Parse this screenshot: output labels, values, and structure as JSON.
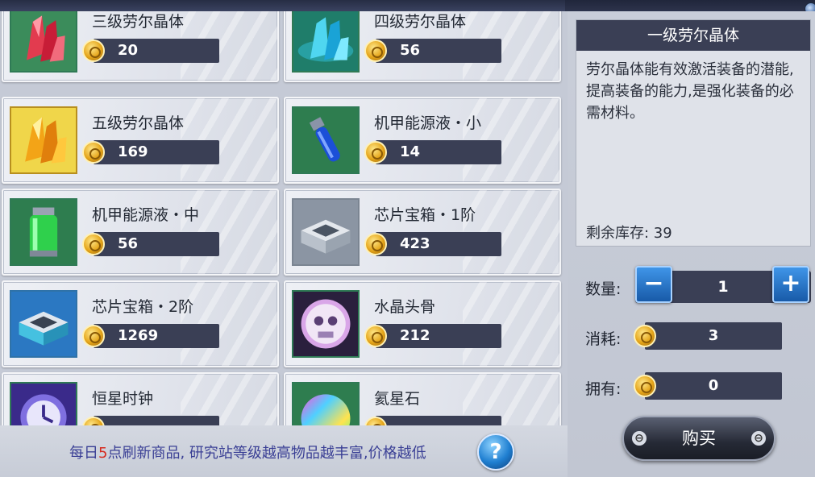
{
  "items": [
    {
      "name": "三级劳尔晶体",
      "price": "20",
      "icon": "red-crystal-icon"
    },
    {
      "name": "四级劳尔晶体",
      "price": "56",
      "icon": "cyan-crystal-icon"
    },
    {
      "name": "五级劳尔晶体",
      "price": "169",
      "icon": "gold-crystal-icon"
    },
    {
      "name": "机甲能源液・小",
      "price": "14",
      "icon": "blue-vial-icon"
    },
    {
      "name": "机甲能源液・中",
      "price": "56",
      "icon": "green-canister-icon"
    },
    {
      "name": "芯片宝箱・1阶",
      "price": "423",
      "icon": "gray-chest-icon"
    },
    {
      "name": "芯片宝箱・2阶",
      "price": "1269",
      "icon": "blue-chest-icon"
    },
    {
      "name": "水晶头骨",
      "price": "212",
      "icon": "crystal-skull-icon"
    },
    {
      "name": "恒星时钟",
      "price": "",
      "icon": "stellar-clock-icon"
    },
    {
      "name": "氦星石",
      "price": "",
      "icon": "helium-stone-icon"
    }
  ],
  "footer": {
    "text_before": "每日",
    "text_highlight": "5",
    "text_after": "点刷新商品, 研究站等级越高物品越丰富,价格越低",
    "help_label": "?"
  },
  "detail": {
    "title": "一级劳尔晶体",
    "description": "劳尔晶体能有效激活装备的潜能,提高装备的能力,是强化装备的必需材料。",
    "stock_text": "剩余库存: 39",
    "quantity_label": "数量:",
    "quantity_value": "1",
    "minus_label": "−",
    "plus_label": "+",
    "cost_label": "消耗:",
    "cost_value": "3",
    "owned_label": "拥有:",
    "owned_value": "0",
    "buy_label": "购买",
    "buy_knob": "⊖"
  },
  "colors": {
    "accent_blue": "#1f7fd1",
    "footer_text": "#3a3f95",
    "footer_highlight": "#d62a1f",
    "dark_bar": "#3a3f55"
  }
}
